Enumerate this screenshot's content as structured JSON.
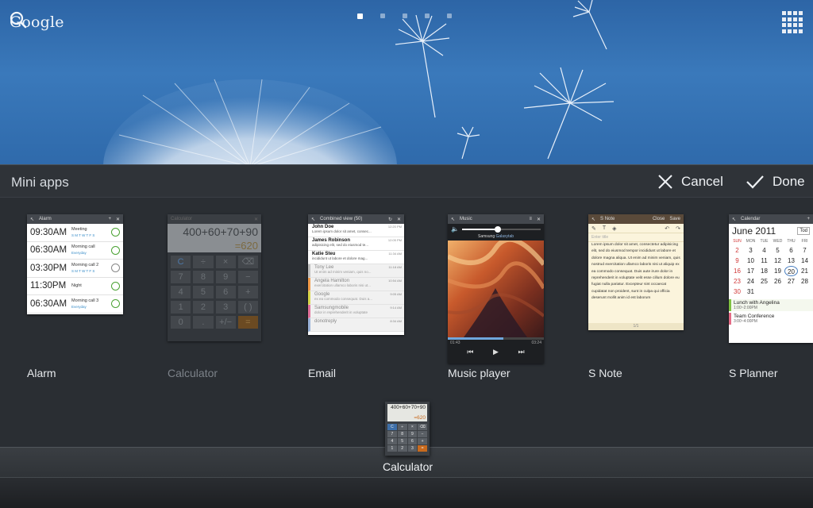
{
  "home": {
    "search_label": "Google",
    "page_dots": 5,
    "active_page": 1
  },
  "panel": {
    "title": "Mini apps",
    "cancel_label": "Cancel",
    "done_label": "Done"
  },
  "apps": [
    {
      "label": "Alarm",
      "available": true
    },
    {
      "label": "Calculator",
      "available": false
    },
    {
      "label": "Email",
      "available": true
    },
    {
      "label": "Music player",
      "available": true
    },
    {
      "label": "S Note",
      "available": true
    },
    {
      "label": "S Planner",
      "available": true
    }
  ],
  "alarm_preview": {
    "title": "Alarm",
    "rows": [
      {
        "time": "09:30AM",
        "name": "Meeting",
        "repeat": "S M T W T F S"
      },
      {
        "time": "06:30AM",
        "name": "Morning call",
        "repeat": "Everyday"
      },
      {
        "time": "03:30PM",
        "name": "Morning call 2",
        "repeat": "S M T W T F S"
      },
      {
        "time": "11:30PM",
        "name": "Night",
        "repeat": ""
      },
      {
        "time": "06:30AM",
        "name": "Morning call 3",
        "repeat": "Everyday"
      }
    ]
  },
  "calculator_preview": {
    "title": "Calculator",
    "expression": "400+60+70+90",
    "result": "=620",
    "keys": [
      "C",
      "÷",
      "×",
      "⌫",
      "7",
      "8",
      "9",
      "−",
      "4",
      "5",
      "6",
      "+",
      "1",
      "2",
      "3",
      "( )",
      "0",
      ".",
      "+/−",
      "="
    ]
  },
  "email_preview": {
    "title": "Combined view (50)",
    "rows": [
      {
        "from": "John Doe",
        "snippet": "Lorem ipsum dolor sit amet, consec...",
        "time": "12:20 PM",
        "read": false
      },
      {
        "from": "James Robinson",
        "snippet": "adipisicing elit, sed do eiusmod te...",
        "time": "12:05 PM",
        "read": false
      },
      {
        "from": "Katie Steu",
        "snippet": "incididunt ut labore et dolore mag...",
        "time": "11:34 AM",
        "read": false
      },
      {
        "from": "Tony Lee",
        "snippet": "Ut enim ad minim veniam, quis no...",
        "time": "11:18 AM",
        "read": true
      },
      {
        "from": "Angela Hamilton",
        "snippet": "exercitation ullamco laboris nisi ut...",
        "time": "10:54 AM",
        "read": true
      },
      {
        "from": "Google",
        "snippet": "ex ea commodo consequat. Duis a...",
        "time": "9:05 AM",
        "read": true
      },
      {
        "from": "Samsungmobile",
        "snippet": "dolor in reprehenderit in voluptate",
        "time": "9:14 AM",
        "read": true
      },
      {
        "from": "donotreply",
        "snippet": "",
        "time": "8:34 AM",
        "read": true
      }
    ]
  },
  "music_preview": {
    "title": "Music",
    "artist": "Samsung",
    "album": "Galaxytab",
    "elapsed": "01:43",
    "duration": "03:24",
    "volume": 0.45,
    "progress": 0.58
  },
  "snote_preview": {
    "title": "S Note",
    "close": "Close",
    "save": "Save",
    "placeholder": "Enter title",
    "body": "Lorem ipsum dolor sit amet, consectetur adipisicing elit, sed do eiusmod tempor incididunt ut labore et dolore magna aliqua. Ut enim ad minim veniam, quis nostrud exercitation ullamco laboris nisi ut aliquip ex ea commodo consequat. Duis aute irure dolor in reprehenderit in voluptate velit esse cillum dolore eu fugiat nulla pariatur. Excepteur sint occaecat cupidatat non proident, sunt in culpa qui officia deserunt mollit anim id est laborum",
    "page": "1/1"
  },
  "calendar_preview": {
    "title": "Calendar",
    "month": "June 2011",
    "today_label": "Tod",
    "days": [
      "SUN",
      "MON",
      "TUE",
      "WED",
      "THU",
      "FRI"
    ],
    "weeks": [
      [
        "2",
        "3",
        "4",
        "5",
        "6",
        "7"
      ],
      [
        "9",
        "10",
        "11",
        "12",
        "13",
        "14"
      ],
      [
        "16",
        "17",
        "18",
        "19",
        "20",
        "21"
      ],
      [
        "23",
        "24",
        "25",
        "26",
        "27",
        "28"
      ],
      [
        "30",
        "31",
        "",
        "",
        "",
        ""
      ]
    ],
    "selected_day": "20",
    "events": [
      {
        "title": "Lunch with Angelina",
        "time": "1:00~2:00PM"
      },
      {
        "title": "Team Conference",
        "time": "3:00~4:00PM"
      }
    ]
  },
  "floating_calculator": {
    "label": "Calculator",
    "expression": "400+60+70+90",
    "result": "=620",
    "keys": [
      "C",
      "÷",
      "×",
      "⌫",
      "7",
      "8",
      "9",
      "−",
      "4",
      "5",
      "6",
      "+",
      "1",
      "2",
      "3",
      "="
    ]
  },
  "colors": {
    "wallpaper": "#3a79bb",
    "panel": "#2a2e33",
    "alarm_icon": "#4aa233",
    "accent_orange": "#c86a1e"
  },
  "icons": {
    "search": "search-icon",
    "apps": "apps-grid-icon",
    "cancel": "close-icon",
    "done": "check-icon"
  }
}
